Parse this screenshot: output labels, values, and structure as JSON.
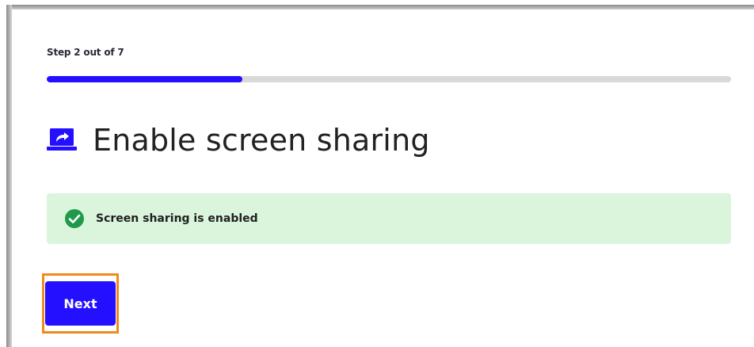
{
  "wizard": {
    "step_label": "Step 2 out of 7",
    "current_step": 2,
    "total_steps": 7,
    "progress_fraction": 0.2857
  },
  "header": {
    "title": "Enable screen sharing",
    "icon": "screen-share-icon"
  },
  "status": {
    "message": "Screen sharing is enabled",
    "icon": "check-circle-icon",
    "background_color": "#daf5dc",
    "icon_color": "#1f9a4a"
  },
  "actions": {
    "next_label": "Next",
    "accent_color": "#2410ff",
    "highlight_color": "#f08a1a"
  }
}
